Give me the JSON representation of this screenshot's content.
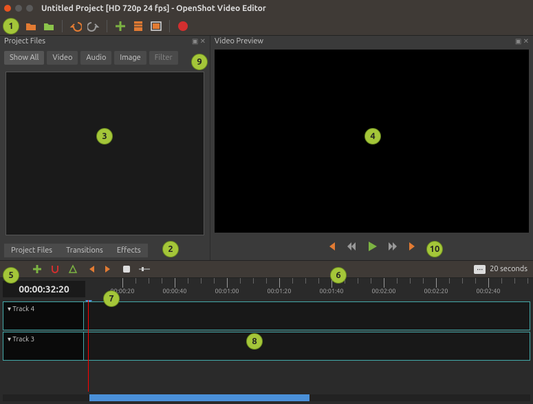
{
  "window": {
    "title": "Untitled Project [HD 720p 24 fps] - OpenShot Video Editor"
  },
  "panels": {
    "project_files_title": "Project Files",
    "video_preview_title": "Video Preview"
  },
  "filter_tabs": {
    "show_all": "Show All",
    "video": "Video",
    "audio": "Audio",
    "image": "Image",
    "filter": "Filter"
  },
  "bottom_tabs": {
    "project_files": "Project Files",
    "transitions": "Transitions",
    "effects": "Effects"
  },
  "timeline": {
    "timecode": "00:00:32:20",
    "zoom_label": "20 seconds",
    "ruler_labels": [
      "00:00:20",
      "00:00:40",
      "00:01:00",
      "00:01:20",
      "00:01:40",
      "00:02:00",
      "00:02:20",
      "00:02:40"
    ],
    "tracks": [
      {
        "name": "Track 4"
      },
      {
        "name": "Track 3"
      }
    ]
  },
  "callouts": {
    "c1": "1",
    "c2": "2",
    "c3": "3",
    "c4": "4",
    "c5": "5",
    "c6": "6",
    "c7": "7",
    "c8": "8",
    "c9": "9",
    "c10": "10"
  }
}
